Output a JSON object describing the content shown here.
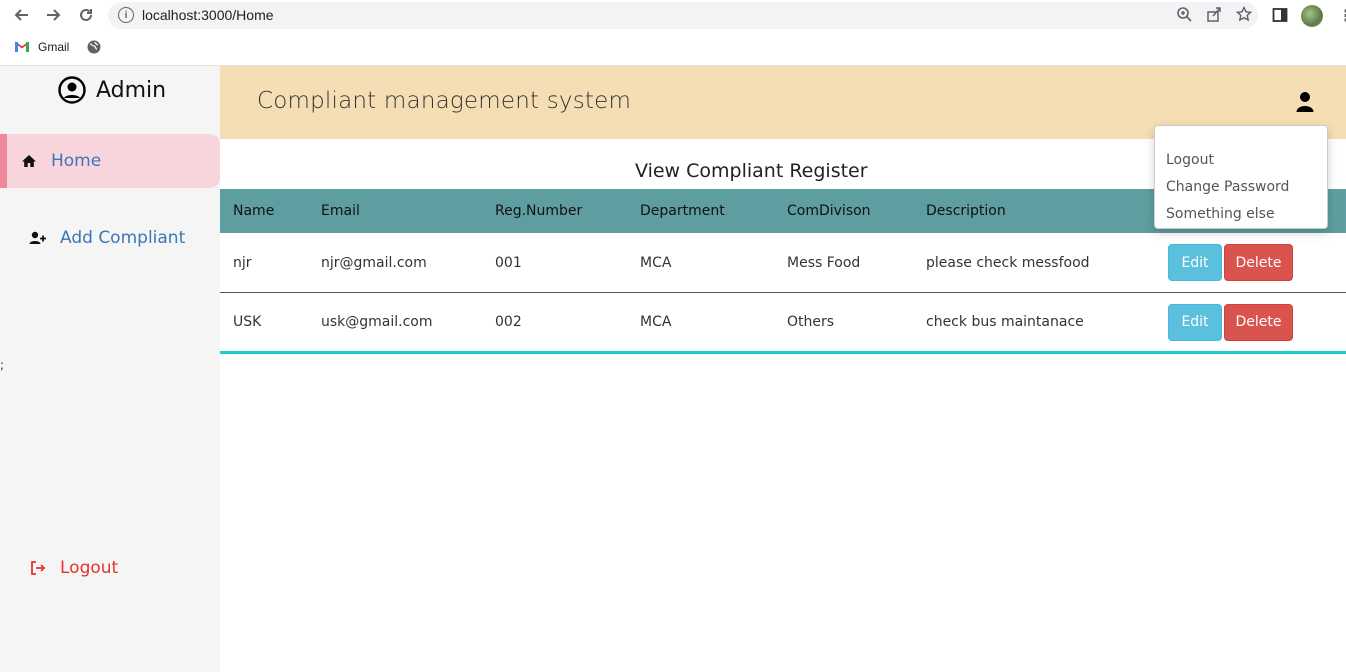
{
  "browser": {
    "url": "localhost:3000/Home",
    "bookmarks": [
      {
        "label": "Gmail",
        "icon": "gmail-icon"
      },
      {
        "label": "",
        "icon": "globe-icon"
      }
    ]
  },
  "sidebar": {
    "brand": "Admin",
    "items": [
      {
        "label": "Home",
        "icon": "home-icon",
        "active": true
      },
      {
        "label": "Add Compliant",
        "icon": "add-user-icon",
        "active": false
      }
    ],
    "stray_text": ";",
    "logout_label": "Logout"
  },
  "header": {
    "title": "Compliant management system"
  },
  "main": {
    "title": "View Compliant Register",
    "columns": [
      "Name",
      "Email",
      "Reg.Number",
      "Department",
      "ComDivison",
      "Description"
    ],
    "rows": [
      {
        "name": "njr",
        "email": "njr@gmail.com",
        "reg": "001",
        "department": "MCA",
        "division": "Mess Food",
        "description": "please check messfood",
        "edit": "Edit",
        "delete": "Delete"
      },
      {
        "name": "USK",
        "email": "usk@gmail.com",
        "reg": "002",
        "department": "MCA",
        "division": "Others",
        "description": "check bus maintanace",
        "edit": "Edit",
        "delete": "Delete"
      }
    ]
  },
  "dropdown": {
    "items": [
      "Logout",
      "Change Password",
      "Something else"
    ]
  },
  "colors": {
    "header_bg": "#f5deb3",
    "sidebar_bg": "#f5f5f5",
    "active_bg": "#f8d5dc",
    "table_head_bg": "#5f9ea0",
    "edit_btn": "#5bc0de",
    "delete_btn": "#d9534f",
    "accent_line": "#1fc9cc",
    "link": "#3a78b5",
    "logout": "#e3342f"
  }
}
